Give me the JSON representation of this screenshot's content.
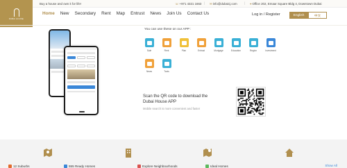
{
  "topbar": {
    "tagline": "Buy a house and own it for life!",
    "phone": "+971 4321 1663",
    "email": "info@dubaicj.com",
    "address": "Office 202, Emaar Square Bldg 4, Downtown Dubai"
  },
  "logo": {
    "text": "DUBAI HOUSE"
  },
  "nav": {
    "items": [
      "Home",
      "New",
      "Secondary",
      "Rent",
      "Map",
      "Entrust",
      "News",
      "Join Us",
      "Contact Us"
    ],
    "login": "Log in / Register",
    "lang_en": "English",
    "lang_cn": "中文"
  },
  "app": {
    "intro": "You can use these on our APP :",
    "features": [
      {
        "label": "Sale",
        "color": "#3ab0d6"
      },
      {
        "label": "Rent",
        "color": "#f0a13a"
      },
      {
        "label": "Plan",
        "color": "#f0c13a"
      },
      {
        "label": "Entrust",
        "color": "#f0a13a"
      },
      {
        "label": "Mortgage",
        "color": "#3ab0d6"
      },
      {
        "label": "Education",
        "color": "#3ab0d6"
      },
      {
        "label": "Region",
        "color": "#3ab0d6"
      },
      {
        "label": "Investment",
        "color": "#3a87d8"
      },
      {
        "label": "News",
        "color": "#f0a13a"
      },
      {
        "label": "Tools",
        "color": "#3ab0d6"
      }
    ],
    "qr_title_1": "Scan the QR code to download the",
    "qr_title_2": "Dubai House APP",
    "qr_subtitle": "Mobile search is more convenient and faster"
  },
  "bottom": {
    "tabs": [
      {
        "label": "12 Suburbs",
        "color": "#e26b2d"
      },
      {
        "label": "555 Ready Homes",
        "color": "#3a87d8"
      },
      {
        "label": "Explore Neighbourhoods",
        "color": "#d9534f"
      },
      {
        "label": "Ideal Homes",
        "color": "#5cb85c"
      }
    ],
    "show_all": "Show All"
  },
  "colors": {
    "accent": "#b08f4e",
    "blue": "#3a87d8"
  }
}
